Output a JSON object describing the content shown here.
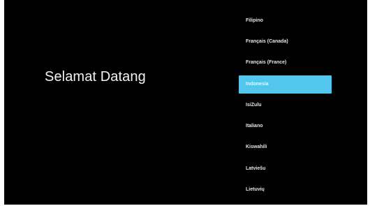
{
  "welcome_text": "Selamat Datang",
  "languages": [
    {
      "label": "Filipino"
    },
    {
      "label": "Français (Canada)"
    },
    {
      "label": "Français (France)"
    },
    {
      "label": "Indonesia",
      "selected": true
    },
    {
      "label": "IsiZulu"
    },
    {
      "label": "Italiano"
    },
    {
      "label": "Kiswahili"
    },
    {
      "label": "Latviešu"
    },
    {
      "label": "Lietuvių"
    }
  ],
  "colors": {
    "background": "#000000",
    "highlight": "#52c6ec",
    "text": "#e6e6e6"
  }
}
